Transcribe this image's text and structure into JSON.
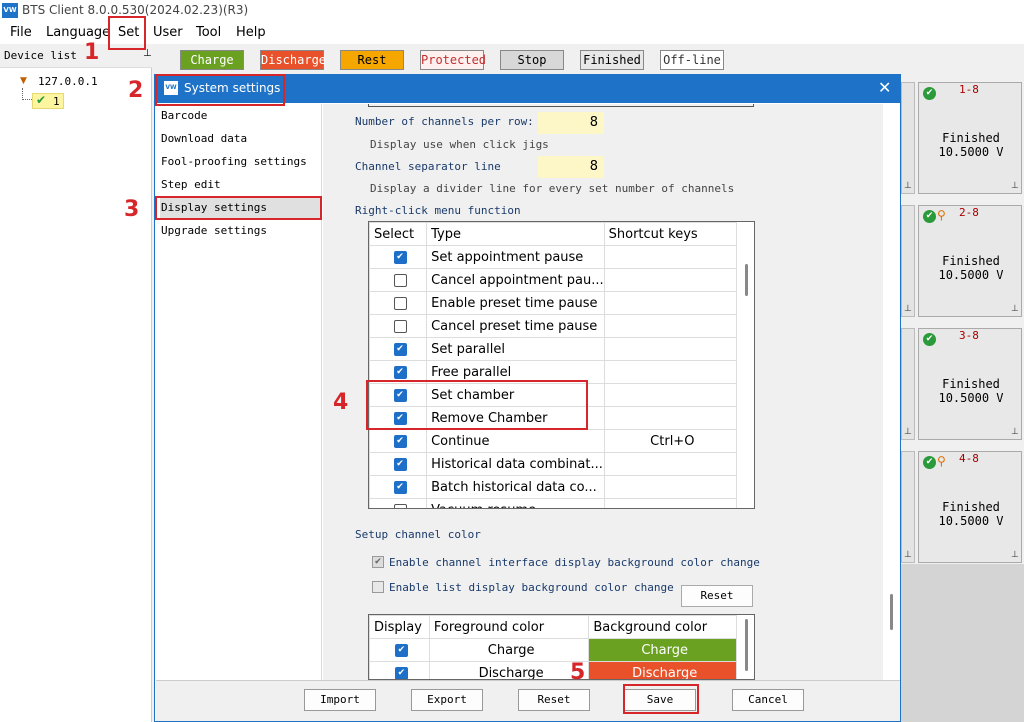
{
  "window": {
    "title": "BTS Client 8.0.0.530(2024.02.23)(R3)",
    "icon": "VW"
  },
  "menu": [
    "File",
    "Language",
    "Set",
    "User",
    "Tool",
    "Help"
  ],
  "device_list": {
    "header": "Device list",
    "ip": "127.0.0.1",
    "device": "1"
  },
  "legend": [
    {
      "label": "Charge",
      "bg": "#6aa121",
      "fg": "#ffffff"
    },
    {
      "label": "Discharge",
      "bg": "#e8512a",
      "fg": "#ffffff"
    },
    {
      "label": "Rest",
      "bg": "#f5a700",
      "fg": "#000000"
    },
    {
      "label": "Protected",
      "bg": "#fff0f0",
      "fg": "#c03030"
    },
    {
      "label": "Stop",
      "bg": "#d8d8d8",
      "fg": "#000000"
    },
    {
      "label": "Finished",
      "bg": "#e8e8e8",
      "fg": "#000000"
    },
    {
      "label": "Off-line",
      "bg": "#ffffff",
      "fg": "#333333"
    }
  ],
  "channels": [
    {
      "id": "1-8",
      "status": "Finished",
      "voltage": "10.5000 V",
      "warn": false
    },
    {
      "id": "2-8",
      "status": "Finished",
      "voltage": "10.5000 V",
      "warn": true
    },
    {
      "id": "3-8",
      "status": "Finished",
      "voltage": "10.5000 V",
      "warn": false
    },
    {
      "id": "4-8",
      "status": "Finished",
      "voltage": "10.5000 V",
      "warn": true
    }
  ],
  "dialog": {
    "title": "System settings",
    "nav": [
      "Barcode",
      "Download data",
      "Fool-proofing settings",
      "Step edit",
      "Display settings",
      "Upgrade settings"
    ],
    "selected_nav": "Display settings",
    "channels_per_row_label": "Number of channels per row:",
    "channels_per_row": "8",
    "channels_per_row_hint": "Display use when click jigs",
    "separator_label": "Channel separator line",
    "separator": "8",
    "separator_hint": "Display a divider line for every set number of channels",
    "right_click_label": "Right-click menu function",
    "right_click_headers": [
      "Select",
      "Type",
      "Shortcut keys"
    ],
    "right_click_rows": [
      {
        "checked": true,
        "type": "Set appointment pause",
        "shortcut": ""
      },
      {
        "checked": false,
        "type": "Cancel appointment pau...",
        "shortcut": ""
      },
      {
        "checked": false,
        "type": "Enable preset time pause",
        "shortcut": ""
      },
      {
        "checked": false,
        "type": "Cancel preset time pause",
        "shortcut": ""
      },
      {
        "checked": true,
        "type": "Set parallel",
        "shortcut": ""
      },
      {
        "checked": true,
        "type": "Free parallel",
        "shortcut": ""
      },
      {
        "checked": true,
        "type": "Set chamber",
        "shortcut": ""
      },
      {
        "checked": true,
        "type": "Remove Chamber",
        "shortcut": ""
      },
      {
        "checked": true,
        "type": "Continue",
        "shortcut": "Ctrl+O"
      },
      {
        "checked": true,
        "type": "Historical data combinat...",
        "shortcut": ""
      },
      {
        "checked": true,
        "type": "Batch historical data co...",
        "shortcut": ""
      },
      {
        "checked": false,
        "type": "Vacuum resume",
        "shortcut": ""
      }
    ],
    "color_label": "Setup channel color",
    "enable_iface_bg": "Enable channel interface display background color change",
    "enable_list_bg": "Enable list display background color change",
    "reset_label": "Reset",
    "color_headers": [
      "Display",
      "Foreground color",
      "Background color"
    ],
    "color_rows": [
      {
        "checked": true,
        "fg_text": "Charge",
        "bg_text": "Charge",
        "bg": "#6aa121"
      },
      {
        "checked": true,
        "fg_text": "Discharge",
        "bg_text": "Discharge",
        "bg": "#e8512a"
      }
    ],
    "buttons": [
      "Import",
      "Export",
      "Reset",
      "Save",
      "Cancel"
    ]
  },
  "annotations": [
    "1",
    "2",
    "3",
    "4",
    "5"
  ]
}
